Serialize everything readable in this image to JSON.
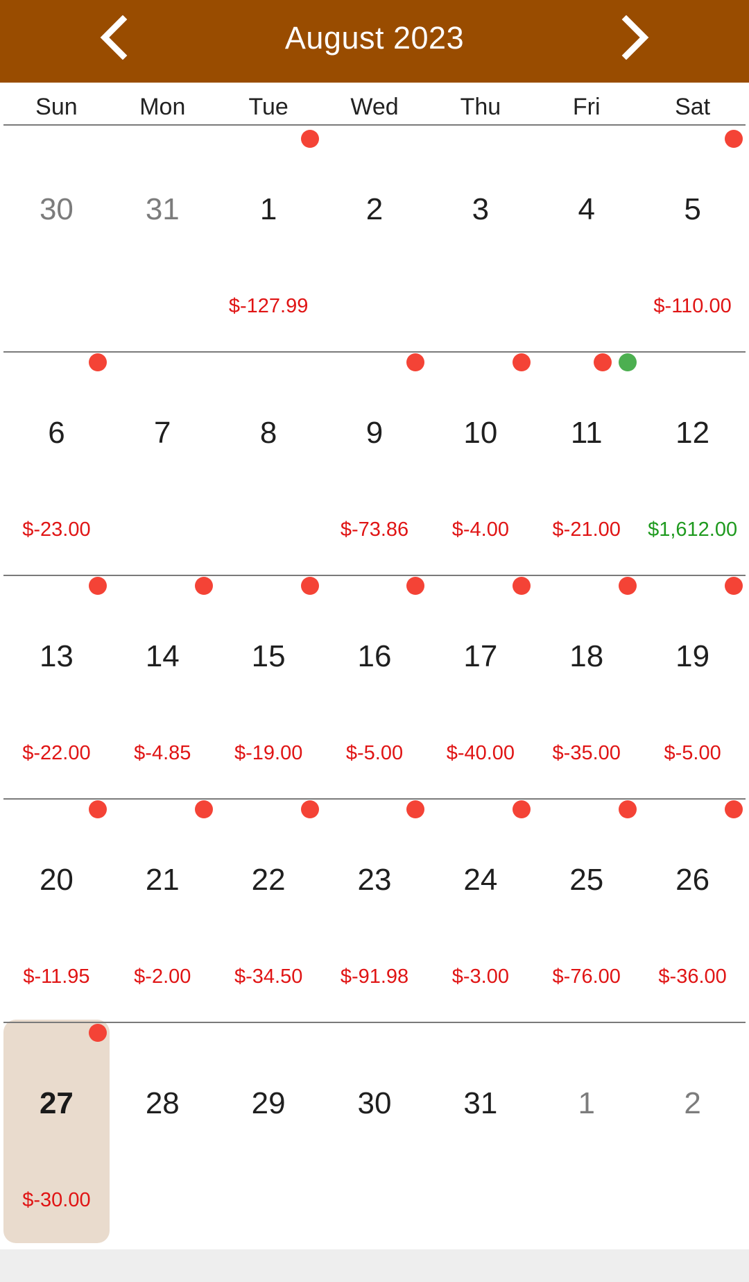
{
  "header": {
    "title": "August 2023",
    "prev_icon": "chevron-left-icon",
    "next_icon": "chevron-right-icon",
    "background": "#994c00"
  },
  "weekdays": [
    "Sun",
    "Mon",
    "Tue",
    "Wed",
    "Thu",
    "Fri",
    "Sat"
  ],
  "colors": {
    "expense": "#e01414",
    "income": "#1f9a1f",
    "dot_red": "#f44336",
    "dot_green": "#4caf50",
    "selected_bg": "#e9dbcd"
  },
  "weeks": [
    [
      {
        "day": "30",
        "other": true,
        "amount": "",
        "dots": []
      },
      {
        "day": "31",
        "other": true,
        "amount": "",
        "dots": []
      },
      {
        "day": "1",
        "amount": "$-127.99",
        "kind": "neg",
        "dots": [
          "red"
        ]
      },
      {
        "day": "2",
        "amount": "",
        "dots": []
      },
      {
        "day": "3",
        "amount": "",
        "dots": []
      },
      {
        "day": "4",
        "amount": "",
        "dots": []
      },
      {
        "day": "5",
        "amount": "$-110.00",
        "kind": "neg",
        "dots": [
          "red"
        ]
      }
    ],
    [
      {
        "day": "6",
        "amount": "$-23.00",
        "kind": "neg",
        "dots": [
          "red"
        ]
      },
      {
        "day": "7",
        "amount": "",
        "dots": []
      },
      {
        "day": "8",
        "amount": "",
        "dots": []
      },
      {
        "day": "9",
        "amount": "$-73.86",
        "kind": "neg",
        "dots": [
          "red"
        ]
      },
      {
        "day": "10",
        "amount": "$-4.00",
        "kind": "neg",
        "dots": [
          "red"
        ]
      },
      {
        "day": "11",
        "amount": "$-21.00",
        "kind": "neg",
        "dots": [
          "red",
          "green"
        ]
      },
      {
        "day": "12",
        "amount": "$1,612.00",
        "kind": "pos",
        "dots": []
      }
    ],
    [
      {
        "day": "13",
        "amount": "$-22.00",
        "kind": "neg",
        "dots": [
          "red"
        ]
      },
      {
        "day": "14",
        "amount": "$-4.85",
        "kind": "neg",
        "dots": [
          "red"
        ]
      },
      {
        "day": "15",
        "amount": "$-19.00",
        "kind": "neg",
        "dots": [
          "red"
        ]
      },
      {
        "day": "16",
        "amount": "$-5.00",
        "kind": "neg",
        "dots": [
          "red"
        ]
      },
      {
        "day": "17",
        "amount": "$-40.00",
        "kind": "neg",
        "dots": [
          "red"
        ]
      },
      {
        "day": "18",
        "amount": "$-35.00",
        "kind": "neg",
        "dots": [
          "red"
        ]
      },
      {
        "day": "19",
        "amount": "$-5.00",
        "kind": "neg",
        "dots": [
          "red"
        ]
      }
    ],
    [
      {
        "day": "20",
        "amount": "$-11.95",
        "kind": "neg",
        "dots": [
          "red"
        ]
      },
      {
        "day": "21",
        "amount": "$-2.00",
        "kind": "neg",
        "dots": [
          "red"
        ]
      },
      {
        "day": "22",
        "amount": "$-34.50",
        "kind": "neg",
        "dots": [
          "red"
        ]
      },
      {
        "day": "23",
        "amount": "$-91.98",
        "kind": "neg",
        "dots": [
          "red"
        ]
      },
      {
        "day": "24",
        "amount": "$-3.00",
        "kind": "neg",
        "dots": [
          "red"
        ]
      },
      {
        "day": "25",
        "amount": "$-76.00",
        "kind": "neg",
        "dots": [
          "red"
        ]
      },
      {
        "day": "26",
        "amount": "$-36.00",
        "kind": "neg",
        "dots": [
          "red"
        ]
      }
    ],
    [
      {
        "day": "27",
        "selected": true,
        "amount": "$-30.00",
        "kind": "neg",
        "dots": [
          "red"
        ]
      },
      {
        "day": "28",
        "amount": "",
        "dots": []
      },
      {
        "day": "29",
        "amount": "",
        "dots": []
      },
      {
        "day": "30",
        "amount": "",
        "dots": []
      },
      {
        "day": "31",
        "amount": "",
        "dots": []
      },
      {
        "day": "1",
        "other": true,
        "amount": "",
        "dots": []
      },
      {
        "day": "2",
        "other": true,
        "amount": "",
        "dots": []
      }
    ]
  ]
}
